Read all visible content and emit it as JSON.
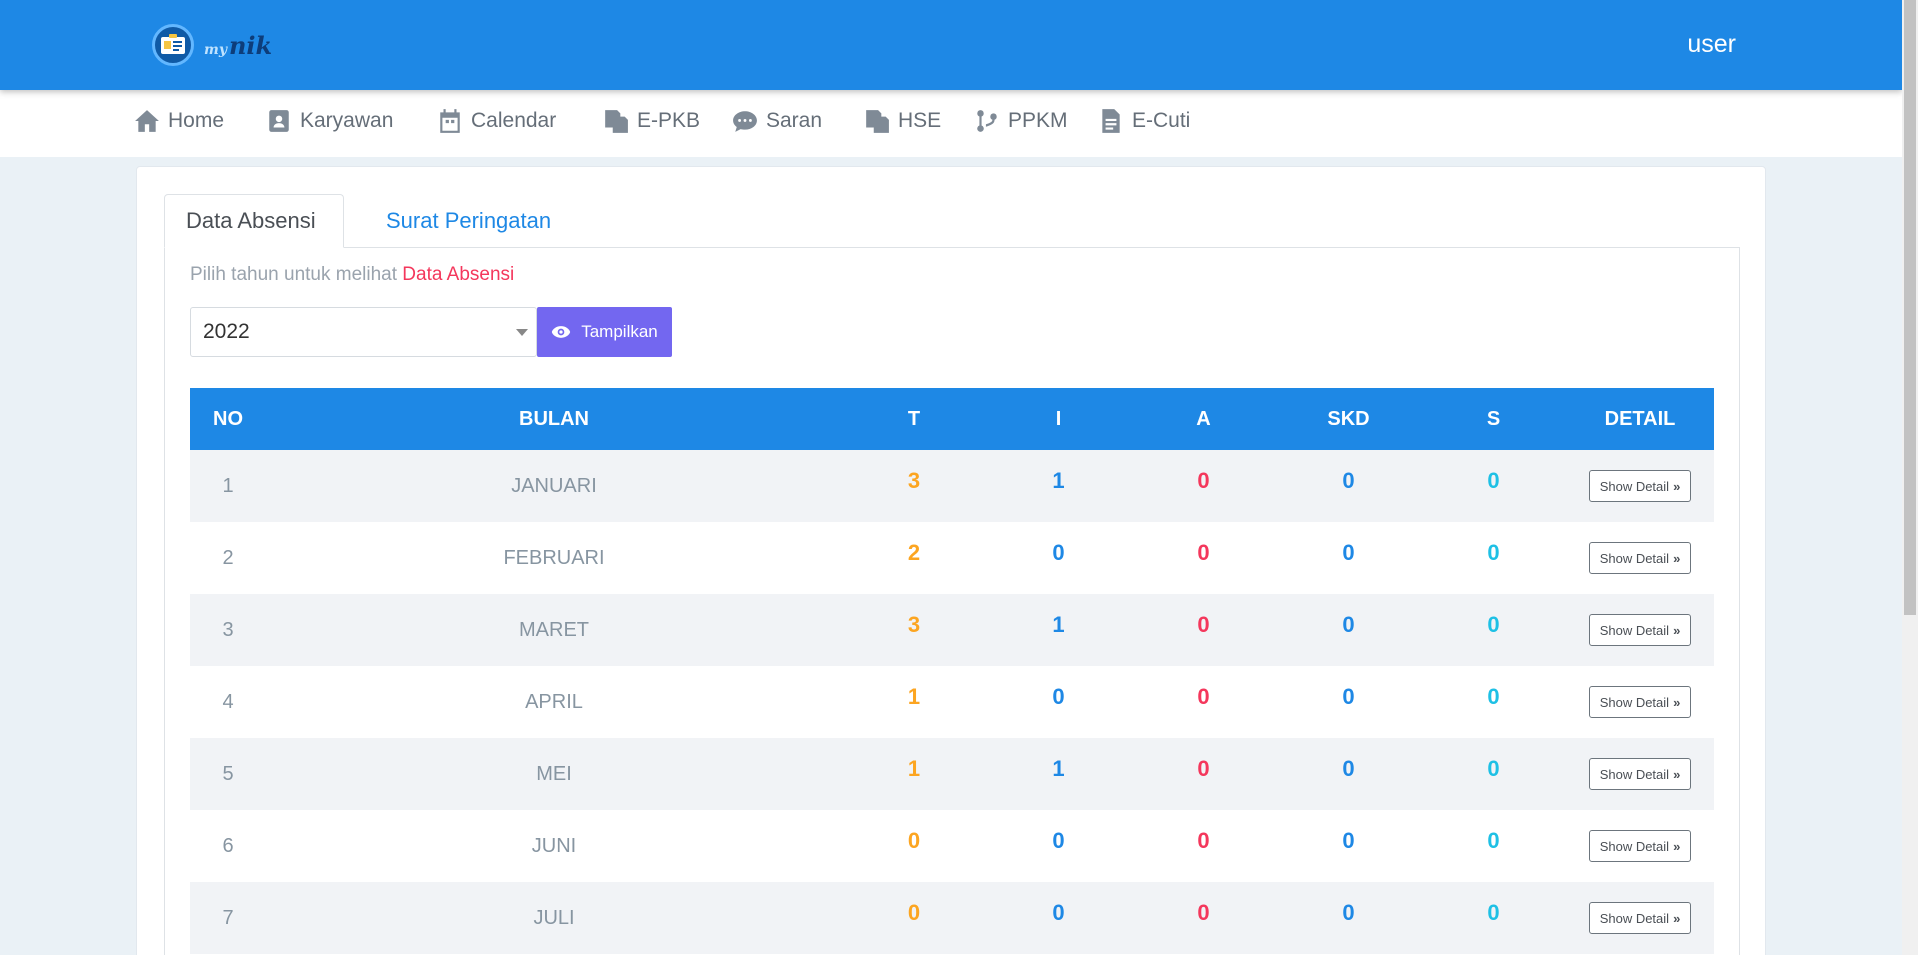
{
  "header": {
    "logo_small": "my",
    "logo_main": "nik",
    "user": "user"
  },
  "nav": [
    {
      "label": "Home",
      "icon": "home-icon"
    },
    {
      "label": "Karyawan",
      "icon": "contact-card-icon"
    },
    {
      "label": "Calendar",
      "icon": "calendar-icon"
    },
    {
      "label": "E-PKB",
      "icon": "copy-document-icon"
    },
    {
      "label": "Saran",
      "icon": "chat-bubble-icon"
    },
    {
      "label": "HSE",
      "icon": "copy-document-icon"
    },
    {
      "label": "PPKM",
      "icon": "code-branch-icon"
    },
    {
      "label": "E-Cuti",
      "icon": "file-text-icon"
    }
  ],
  "tabs": {
    "active": "Data Absensi",
    "inactive": "Surat Peringatan"
  },
  "filter": {
    "hint_prefix": "Pilih tahun untuk melihat",
    "hint_accent": "Data Absensi",
    "year": "2022",
    "button": "Tampilkan"
  },
  "table": {
    "headers": [
      "NO",
      "BULAN",
      "T",
      "I",
      "A",
      "SKD",
      "S",
      "DETAIL"
    ],
    "detail_label": "Show Detail",
    "rows": [
      {
        "no": "1",
        "bulan": "JANUARI",
        "t": "3",
        "i": "1",
        "a": "0",
        "skd": "0",
        "s": "0"
      },
      {
        "no": "2",
        "bulan": "FEBRUARI",
        "t": "2",
        "i": "0",
        "a": "0",
        "skd": "0",
        "s": "0"
      },
      {
        "no": "3",
        "bulan": "MARET",
        "t": "3",
        "i": "1",
        "a": "0",
        "skd": "0",
        "s": "0"
      },
      {
        "no": "4",
        "bulan": "APRIL",
        "t": "1",
        "i": "0",
        "a": "0",
        "skd": "0",
        "s": "0"
      },
      {
        "no": "5",
        "bulan": "MEI",
        "t": "1",
        "i": "1",
        "a": "0",
        "skd": "0",
        "s": "0"
      },
      {
        "no": "6",
        "bulan": "JUNI",
        "t": "0",
        "i": "0",
        "a": "0",
        "skd": "0",
        "s": "0"
      },
      {
        "no": "7",
        "bulan": "JULI",
        "t": "0",
        "i": "0",
        "a": "0",
        "skd": "0",
        "s": "0"
      }
    ]
  },
  "colors": {
    "primary": "#1e88e5",
    "button": "#7367f0",
    "t": "#fca521",
    "a": "#f4375c",
    "s": "#1ec0e5"
  }
}
